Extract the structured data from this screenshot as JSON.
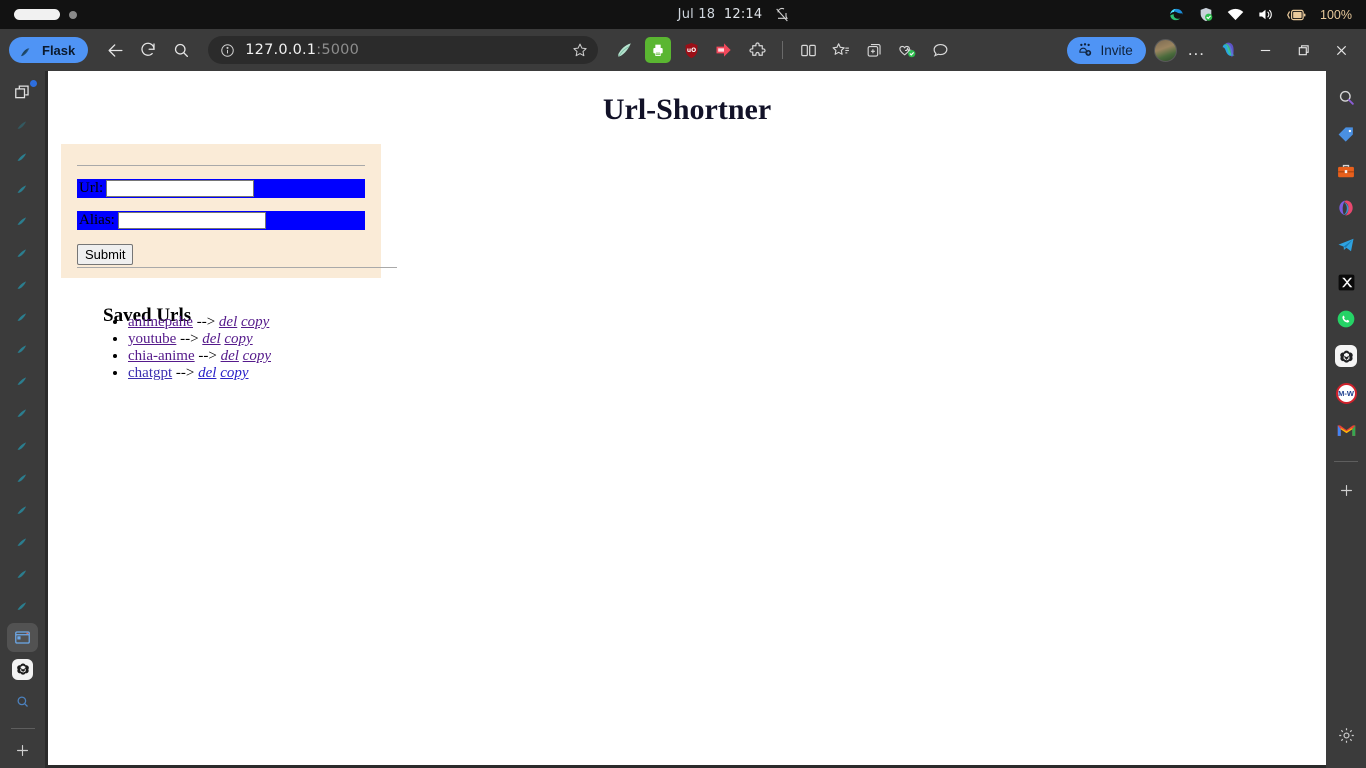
{
  "taskbar": {
    "clock_month": "Jul 18",
    "clock_time": "12:14",
    "notification_icon": "bell-off-icon",
    "tray": {
      "edge_icon": "edge-logo-icon",
      "security_icon": "shield-check-icon",
      "wifi_icon": "wifi-icon",
      "volume_icon": "volume-icon",
      "battery_icon": "battery-charging-icon",
      "battery_label": "100%"
    }
  },
  "browser": {
    "tab_label": "Flask",
    "tab_icon": "flask-logo-icon",
    "back_icon": "back-arrow-icon",
    "reload_icon": "reload-icon",
    "search_icon": "search-icon",
    "address": {
      "info_icon": "info-circle-icon",
      "host": "127.0.0.1",
      "port": ":5000",
      "favorite_icon": "star-icon"
    },
    "extensions": [
      {
        "name": "rocket-feather-extension-icon"
      },
      {
        "name": "green-printer-extension-icon"
      },
      {
        "name": "ublock-shield-extension-icon"
      },
      {
        "name": "red-arrow-extension-icon"
      },
      {
        "name": "puzzle-piece-extensions-icon"
      }
    ],
    "tools": [
      {
        "name": "split-screen-icon"
      },
      {
        "name": "favorites-star-list-icon"
      },
      {
        "name": "collections-add-icon"
      },
      {
        "name": "browser-essentials-heart-icon"
      },
      {
        "name": "chat-bubble-icon"
      }
    ],
    "invite_label": "Invite",
    "invite_icon": "invite-people-icon",
    "avatar": "profile-avatar",
    "more_label": "...",
    "copilot_icon": "copilot-icon",
    "window_controls": {
      "minimize": "minimize-icon",
      "maximize": "restore-icon",
      "close": "close-icon"
    }
  },
  "left_sidebar": {
    "top_icon": "tab-copy-badge-icon",
    "tabs": [
      {
        "icon": "flask-logo-icon"
      },
      {
        "icon": "flask-logo-icon"
      },
      {
        "icon": "flask-logo-icon"
      },
      {
        "icon": "flask-logo-icon"
      },
      {
        "icon": "flask-logo-icon"
      },
      {
        "icon": "flask-logo-icon"
      },
      {
        "icon": "flask-logo-icon"
      },
      {
        "icon": "flask-logo-icon"
      },
      {
        "icon": "flask-logo-icon"
      },
      {
        "icon": "flask-logo-icon"
      },
      {
        "icon": "flask-logo-icon"
      },
      {
        "icon": "flask-logo-icon"
      },
      {
        "icon": "flask-logo-icon"
      },
      {
        "icon": "flask-logo-icon"
      },
      {
        "icon": "flask-logo-icon"
      },
      {
        "icon": "flask-logo-icon"
      }
    ],
    "active_tab_icon": "browser-window-icon",
    "openai_icon": "openai-icon",
    "search_icon": "search-icon",
    "add_icon": "plus-icon"
  },
  "right_sidebar": {
    "items": [
      {
        "icon": "search-icon"
      },
      {
        "icon": "price-tag-icon"
      },
      {
        "icon": "briefcase-icon"
      },
      {
        "icon": "microsoft-365-icon"
      },
      {
        "icon": "telegram-icon"
      },
      {
        "icon": "x-twitter-icon"
      },
      {
        "icon": "whatsapp-icon"
      },
      {
        "icon": "openai-icon"
      },
      {
        "icon": "merriam-webster-icon"
      },
      {
        "icon": "gmail-icon"
      }
    ],
    "add_icon": "plus-icon",
    "settings_icon": "gear-icon"
  },
  "page": {
    "title": "Url-Shortner",
    "form": {
      "url_label": "Url:",
      "url_value": "",
      "url_placeholder": "",
      "alias_label": "Alias:",
      "alias_value": "",
      "alias_placeholder": "",
      "submit_label": "Submit"
    },
    "saved": {
      "heading": "Saved Urls",
      "arrow": "-->",
      "items": [
        {
          "name": "animepahe",
          "del": "del",
          "copy": "copy",
          "visited": true
        },
        {
          "name": "youtube",
          "del": "del",
          "copy": "copy",
          "visited": true
        },
        {
          "name": "chia-anime",
          "del": "del",
          "copy": "copy",
          "visited": true
        },
        {
          "name": "chatgpt",
          "del": "del",
          "copy": "copy",
          "visited": false
        }
      ]
    }
  },
  "colors": {
    "form_background": "#faebd7",
    "field_highlight": "#0000ff",
    "accent_blue": "#4f94f5",
    "visited_link": "#551a8b",
    "link": "#2a22c9"
  }
}
